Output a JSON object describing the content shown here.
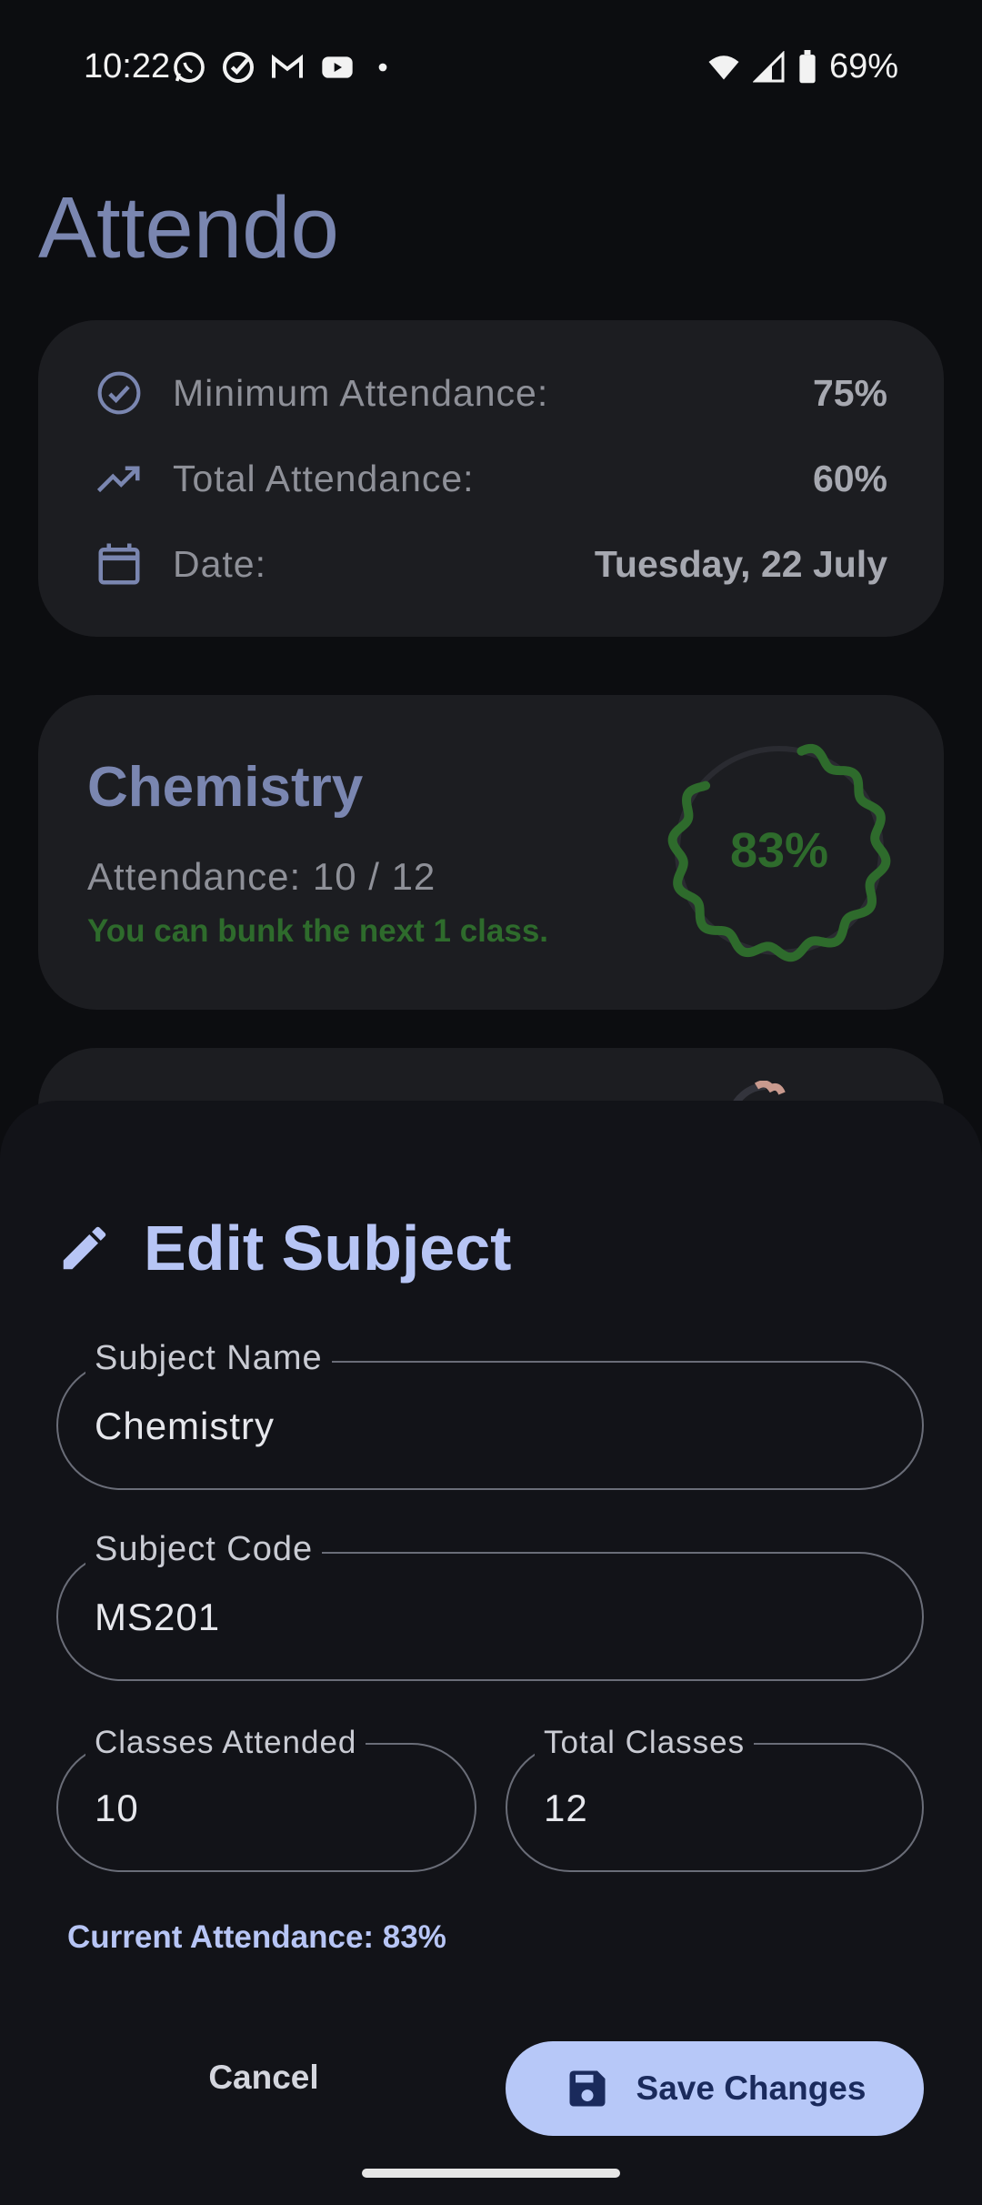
{
  "status_bar": {
    "time": "10:22",
    "battery": "69%",
    "notification_icons": [
      "whatsapp-icon",
      "check-circle-icon",
      "gmail-icon",
      "youtube-icon",
      "dot-icon"
    ]
  },
  "app": {
    "title": "Attendo"
  },
  "summary": {
    "min_label": "Minimum Attendance:",
    "min_value": "75%",
    "total_label": "Total Attendance:",
    "total_value": "60%",
    "date_label": "Date:",
    "date_value": "Tuesday, 22 July"
  },
  "subject_card": {
    "name": "Chemistry",
    "attendance": "Attendance: 10 / 12",
    "message": "You can bunk the next 1 class.",
    "percent_text": "83%",
    "percent_value": 0.83,
    "progress_color": "#2e6b2c"
  },
  "edit_sheet": {
    "title": "Edit Subject",
    "subject_name_label": "Subject Name",
    "subject_name_value": "Chemistry",
    "subject_code_label": "Subject Code",
    "subject_code_value": "MS201",
    "classes_attended_label": "Classes Attended",
    "classes_attended_value": "10",
    "total_classes_label": "Total Classes",
    "total_classes_value": "12",
    "current_attendance": "Current Attendance: 83%",
    "cancel_label": "Cancel",
    "save_label": "Save Changes"
  },
  "colors": {
    "accent": "#b7c5f5",
    "title": "#7a86b0",
    "success": "#2e6b2c",
    "save_button_bg": "#b7c8f8"
  }
}
